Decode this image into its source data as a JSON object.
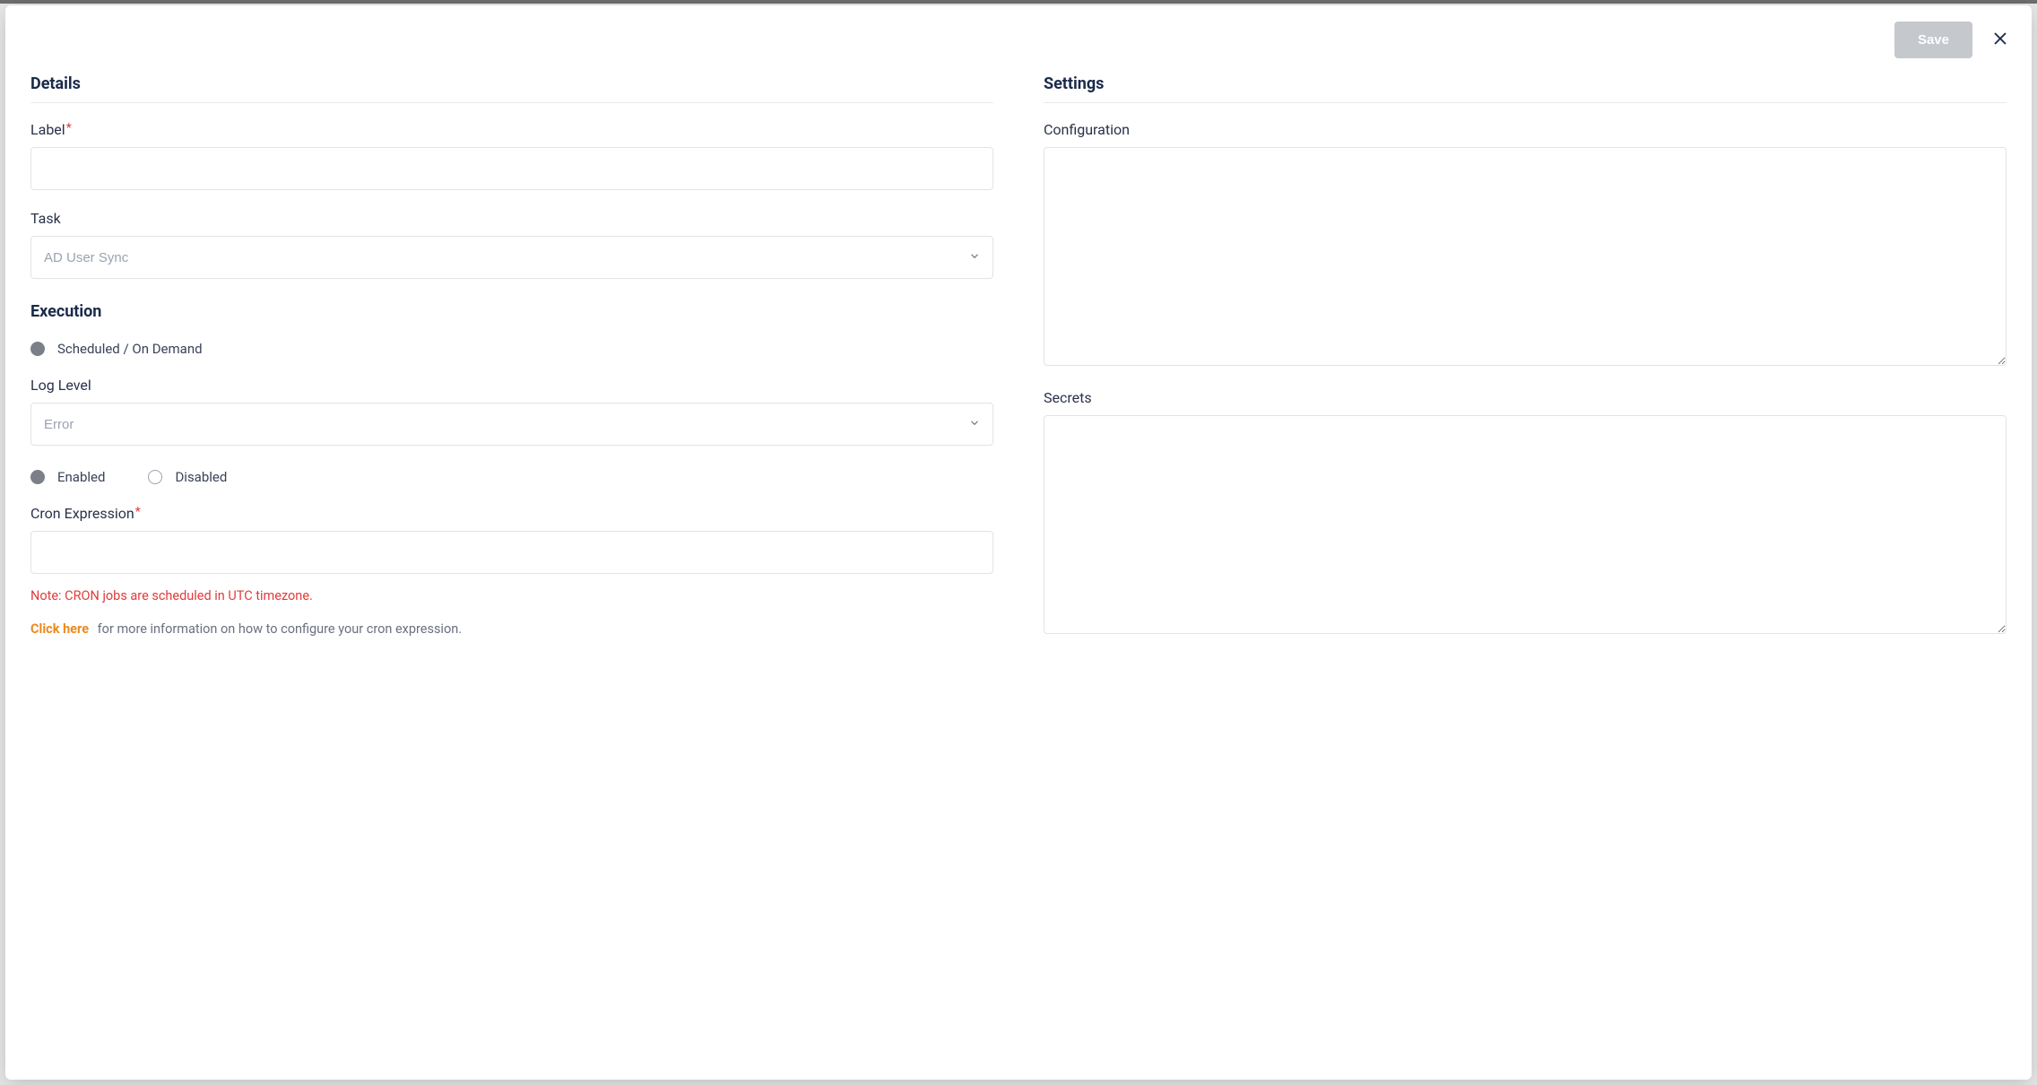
{
  "header": {
    "save_label": "Save"
  },
  "details": {
    "section_title": "Details",
    "label_field_label": "Label",
    "label_value": "",
    "task_field_label": "Task",
    "task_selected": "AD User Sync",
    "execution_title": "Execution",
    "exec_mode_label": "Scheduled / On Demand",
    "loglevel_field_label": "Log Level",
    "loglevel_selected": "Error",
    "status_enabled_label": "Enabled",
    "status_disabled_label": "Disabled",
    "cron_field_label": "Cron Expression",
    "cron_value": "",
    "cron_note": "Note: CRON jobs are scheduled in UTC timezone.",
    "help_link_text": "Click here",
    "help_rest_text": "for more information on how to configure your cron expression."
  },
  "settings": {
    "section_title": "Settings",
    "configuration_label": "Configuration",
    "configuration_value": "",
    "secrets_label": "Secrets",
    "secrets_value": ""
  }
}
